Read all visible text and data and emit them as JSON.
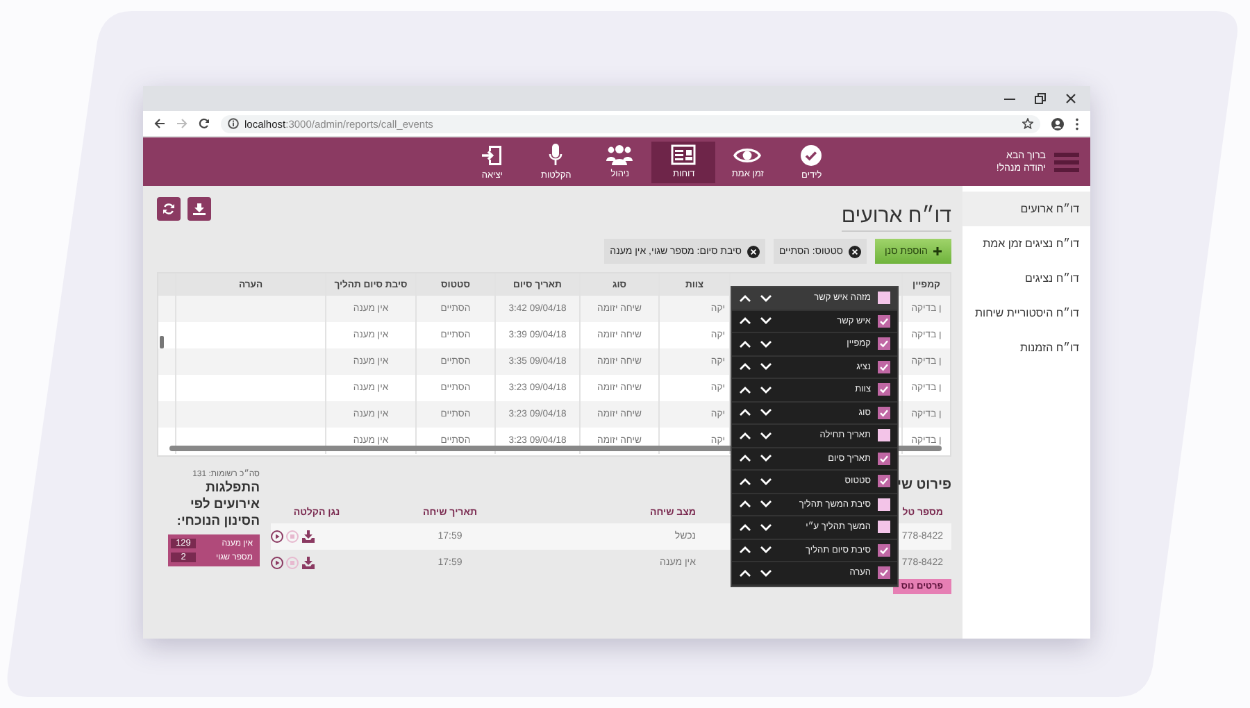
{
  "browser": {
    "url_host": "localhost",
    "url_path": ":3000/admin/reports/call_events"
  },
  "header": {
    "greeting": "ברוך הבא",
    "user": "יהודה מנהל!"
  },
  "nav": [
    {
      "label": "לידים",
      "selected": false
    },
    {
      "label": "זמן אמת",
      "selected": false
    },
    {
      "label": "דוחות",
      "selected": true
    },
    {
      "label": "ניהול",
      "selected": false
    },
    {
      "label": "הקלטות",
      "selected": false
    },
    {
      "label": "יציאה",
      "selected": false
    }
  ],
  "sidebar": [
    {
      "label": "דו״ח ארועים",
      "selected": true
    },
    {
      "label": "דו״ח נציגים זמן אמת",
      "selected": false
    },
    {
      "label": "דו״ח נציגים",
      "selected": false
    },
    {
      "label": "דו״ח היסטוריית שיחות",
      "selected": false
    },
    {
      "label": "דו״ח הזמנות",
      "selected": false
    }
  ],
  "page_title": "דו״ח ארועים",
  "filters": {
    "add_button": "הוספת סנן",
    "chips": [
      "סטטוס: הסתיים",
      "סיבת סיום: מספר שגוי, אין מענה"
    ]
  },
  "table": {
    "columns": [
      "קמפיין",
      "צוות",
      "סוג",
      "תאריך סיום",
      "סטטוס",
      "סיבת סיום תהליך",
      "הערה"
    ],
    "rows": [
      {
        "campaign": "ן בדיקה",
        "team": "יקה",
        "type": "שיחה יזומה",
        "end_date": "3:42 09/04/18",
        "status": "הסתיים",
        "end_reason": "אין מענה"
      },
      {
        "campaign": "ן בדיקה",
        "team": "יקה",
        "type": "שיחה יזומה",
        "end_date": "3:39 09/04/18",
        "status": "הסתיים",
        "end_reason": "אין מענה"
      },
      {
        "campaign": "ן בדיקה",
        "team": "יקה",
        "type": "שיחה יזומה",
        "end_date": "3:35 09/04/18",
        "status": "הסתיים",
        "end_reason": "אין מענה"
      },
      {
        "campaign": "ן בדיקה",
        "team": "יקה",
        "type": "שיחה יזומה",
        "end_date": "3:23 09/04/18",
        "status": "הסתיים",
        "end_reason": "אין מענה"
      },
      {
        "campaign": "ן בדיקה",
        "team": "יקה",
        "type": "שיחה יזומה",
        "end_date": "3:23 09/04/18",
        "status": "הסתיים",
        "end_reason": "אין מענה"
      },
      {
        "campaign": "ן בדיקה",
        "team": "יקה",
        "type": "שיחה יזומה",
        "end_date": "3:23 09/04/18",
        "status": "הסתיים",
        "end_reason": "אין מענה"
      }
    ]
  },
  "column_menu": [
    {
      "label": "מזהה איש קשר",
      "checked": false,
      "hovered": true
    },
    {
      "label": "איש קשר",
      "checked": true,
      "hovered": false
    },
    {
      "label": "קמפיין",
      "checked": true,
      "hovered": false
    },
    {
      "label": "נציג",
      "checked": true,
      "hovered": false
    },
    {
      "label": "צוות",
      "checked": true,
      "hovered": false
    },
    {
      "label": "סוג",
      "checked": true,
      "hovered": false
    },
    {
      "label": "תאריך תחילה",
      "checked": false,
      "hovered": false
    },
    {
      "label": "תאריך סיום",
      "checked": true,
      "hovered": false
    },
    {
      "label": "סטטוס",
      "checked": true,
      "hovered": false
    },
    {
      "label": "סיבת המשך תהליך",
      "checked": false,
      "hovered": false
    },
    {
      "label": "המשך תהליך ע״י",
      "checked": false,
      "hovered": false
    },
    {
      "label": "סיבת סיום תהליך",
      "checked": true,
      "hovered": false
    },
    {
      "label": "הערה",
      "checked": true,
      "hovered": false
    }
  ],
  "details": {
    "title": "פירוט שי",
    "columns": [
      "מספר טל",
      "מצב שיחה",
      "תאריך שיחה",
      "נגן הקלטה"
    ],
    "rows": [
      {
        "phone": "778-8422",
        "state": "נכשל",
        "date": "17:59"
      },
      {
        "phone": "778-8422",
        "state": "אין מענה",
        "date": "17:59"
      }
    ],
    "more_button": "פרטים נוס"
  },
  "stats": {
    "total": "סה״כ רשומות: 131",
    "title": "התפלגות אירועים לפי הסינון הנוכחי:",
    "legend": [
      {
        "label": "אין מענה",
        "count": "129"
      },
      {
        "label": "מספר שגוי",
        "count": "2"
      }
    ]
  }
}
